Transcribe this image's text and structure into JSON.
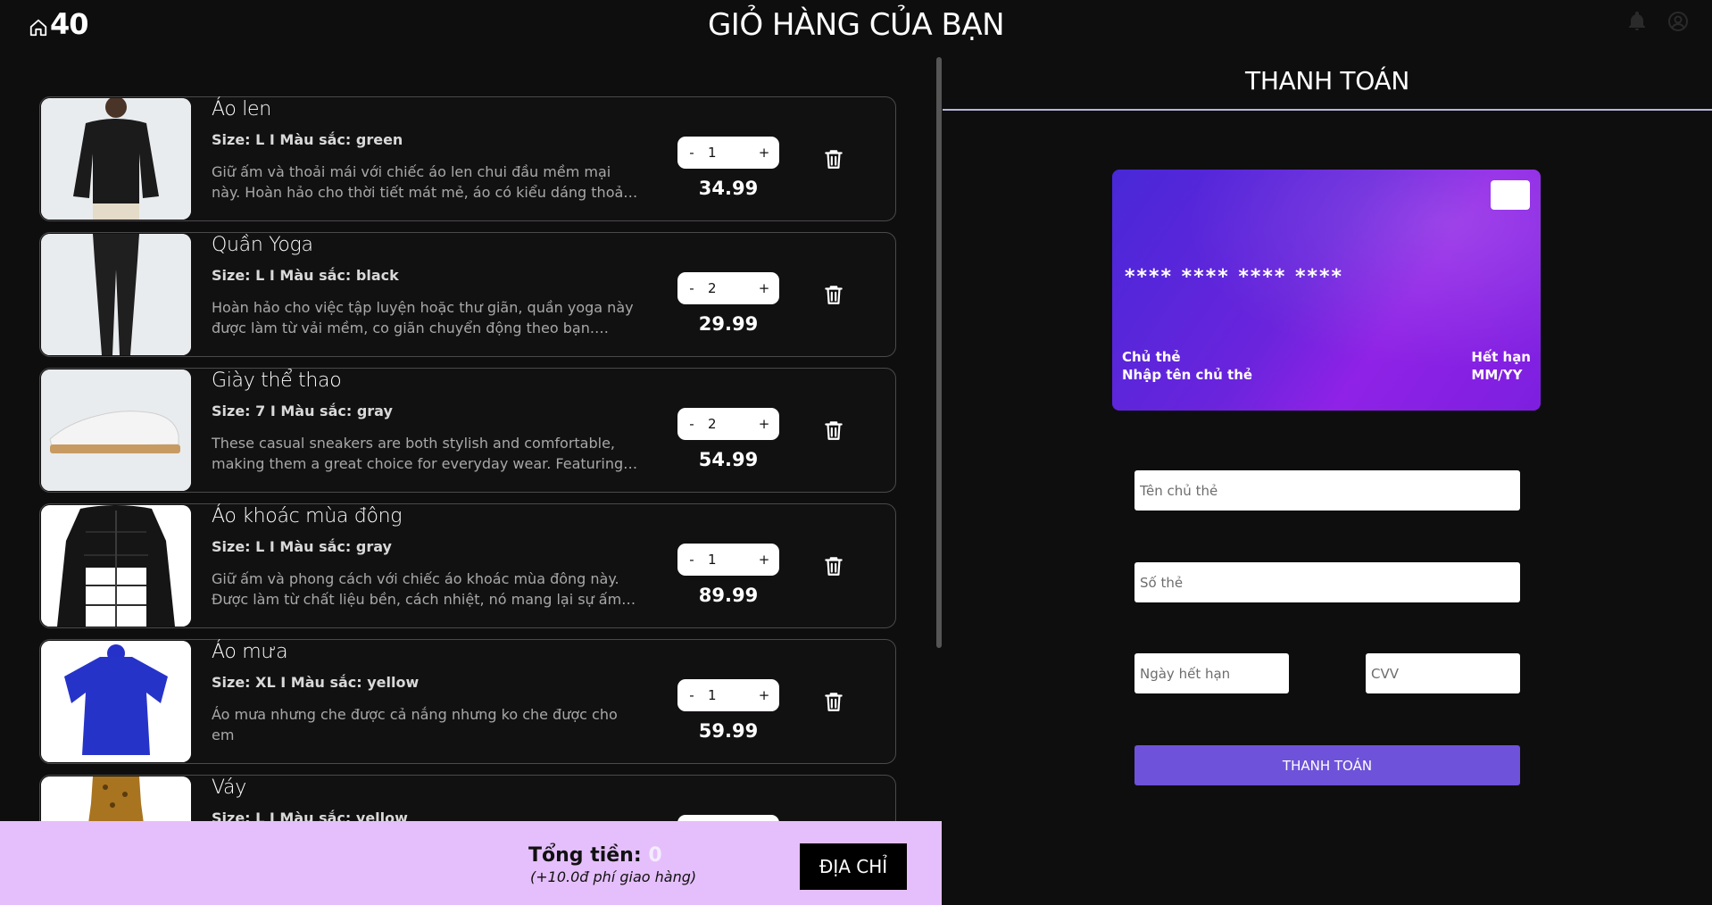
{
  "header": {
    "logo_text": "40",
    "title": "GIỎ HÀNG CỦA BẠN"
  },
  "cart": {
    "items": [
      {
        "name": "Áo len",
        "meta": "Size: L I Màu sắc: green",
        "description": "Giữ ấm và thoải mái với chiếc áo len chui đầu mềm mại này. Hoàn hảo cho thời tiết mát mẻ, áo có kiểu dáng thoải mái v...",
        "minus": "-",
        "quantity": "1",
        "plus": "+",
        "price": "34.99",
        "image": "sweater"
      },
      {
        "name": "Quần Yoga",
        "meta": "Size: L I Màu sắc: black",
        "description": "Hoàn hảo cho việc tập luyện hoặc thư giãn, quần yoga này được làm từ vải mềm, co giãn chuyển động theo bạn. Chún...",
        "minus": "-",
        "quantity": "2",
        "plus": "+",
        "price": "29.99",
        "image": "yoga-pants"
      },
      {
        "name": "Giày thể thao",
        "meta": "Size: 7 I Màu sắc: gray",
        "description": "These casual sneakers are both stylish and comfortable, making them a great choice for everyday wear. Featuring a...",
        "minus": "-",
        "quantity": "2",
        "plus": "+",
        "price": "54.99",
        "image": "sneaker"
      },
      {
        "name": "Áo khoác mùa đông",
        "meta": "Size: L I Màu sắc: gray",
        "description": "Giữ ấm và phong cách với chiếc áo khoác mùa đông này. Được làm từ chất liệu bền, cách nhiệt, nó mang lại sự ấm áp...",
        "minus": "-",
        "quantity": "1",
        "plus": "+",
        "price": "89.99",
        "image": "winter-jacket"
      },
      {
        "name": "Áo mưa",
        "meta": "Size: XL I Màu sắc: yellow",
        "description": "Áo mưa nhưng che được cả nắng nhưng ko che được cho em",
        "minus": "-",
        "quantity": "1",
        "plus": "+",
        "price": "59.99",
        "image": "raincoat"
      },
      {
        "name": "Váy",
        "meta": "Size: L I Màu sắc: yellow",
        "description": "",
        "minus": "-",
        "quantity": "",
        "plus": "+",
        "price": "",
        "image": "dress"
      }
    ]
  },
  "summary": {
    "total_label": "Tổng tiền:",
    "total_value": "0",
    "shipping_note": "(+10.0đ phí giao hàng)",
    "address_button": "ĐỊA CHỈ"
  },
  "payment": {
    "title": "THANH TOÁN",
    "card": {
      "number_mask": "**** **** **** ****",
      "holder_label": "Chủ thẻ",
      "holder_value": "Nhập tên chủ thẻ",
      "expiry_label": "Hết hạn",
      "expiry_value": "MM/YY"
    },
    "fields": {
      "holder_placeholder": "Tên chủ thẻ",
      "number_placeholder": "Số thẻ",
      "expiry_placeholder": "Ngày hết hạn",
      "cvv_placeholder": "CVV"
    },
    "submit_label": "THANH TOÁN"
  },
  "colors": {
    "background": "#0f0e0f",
    "bottom_bar": "#e5bffb",
    "pay_button": "#6e52d9",
    "card_gradient_start": "#4828d8",
    "card_gradient_end": "#8f22e6"
  },
  "icons": [
    "home-icon",
    "bell-icon",
    "user-icon",
    "trash-icon"
  ]
}
